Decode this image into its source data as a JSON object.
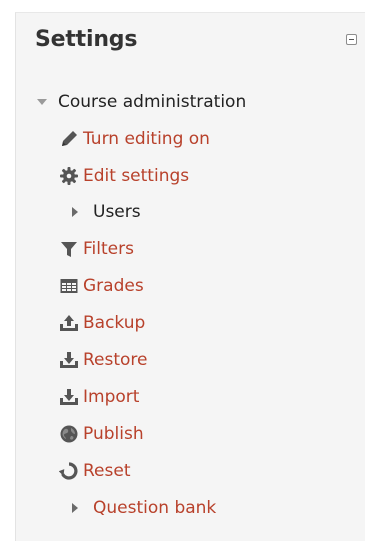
{
  "block": {
    "title": "Settings"
  },
  "tree": {
    "root": {
      "label": "Course administration",
      "expanded": true
    },
    "items": [
      {
        "label": "Turn editing on",
        "icon": "pencil-icon",
        "link": true
      },
      {
        "label": "Edit settings",
        "icon": "gear-icon",
        "link": true
      },
      {
        "label": "Users",
        "icon": "expand-arrow-icon",
        "link": false
      },
      {
        "label": "Filters",
        "icon": "funnel-icon",
        "link": true
      },
      {
        "label": "Grades",
        "icon": "table-icon",
        "link": true
      },
      {
        "label": "Backup",
        "icon": "upload-tray-icon",
        "link": true
      },
      {
        "label": "Restore",
        "icon": "download-tray-icon",
        "link": true
      },
      {
        "label": "Import",
        "icon": "download-tray-icon",
        "link": true
      },
      {
        "label": "Publish",
        "icon": "globe-icon",
        "link": true
      },
      {
        "label": "Reset",
        "icon": "refresh-icon",
        "link": true
      },
      {
        "label": "Question bank",
        "icon": "expand-arrow-icon",
        "link": true
      }
    ]
  },
  "colors": {
    "link": "#b8412b",
    "text": "#222222",
    "icon": "#555555",
    "panel_bg": "#f5f5f5"
  }
}
